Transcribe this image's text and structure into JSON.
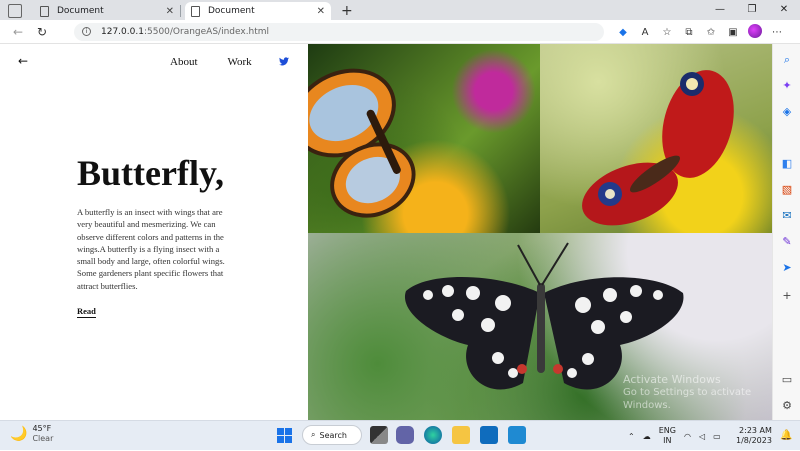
{
  "browser": {
    "tabs": [
      {
        "title": "Document",
        "active": false
      },
      {
        "title": "Document",
        "active": true
      }
    ],
    "new_tab": "+",
    "window_controls": {
      "minimize": "—",
      "maximize": "❐",
      "close": "✕"
    },
    "address": {
      "host": "127.0.0.1",
      "path": ":5500/OrangeAS/index.html"
    }
  },
  "page": {
    "back_icon": "←",
    "nav": {
      "about": "About",
      "work": "Work"
    },
    "social_icon": "twitter-icon",
    "title": "Butterfly,",
    "description": "A butterfly is an insect with wings that are very beautiful and mesmerizing. We can observe different colors and patterns in the wings.A butterfly is a flying insect with a small body and large, often colorful wings. Some gardeners plant specific flowers that attract butterflies.",
    "read_link": "Read",
    "watermark": {
      "line1": "Activate Windows",
      "line2": "Go to Settings to activate Windows."
    }
  },
  "taskbar": {
    "weather": {
      "temp": "45°F",
      "condition": "Clear"
    },
    "search_label": "Search",
    "lang": {
      "line1": "ENG",
      "line2": "IN"
    },
    "clock": {
      "time": "2:23 AM",
      "date": "1/8/2023"
    }
  },
  "colors": {
    "accent": "#1a73e8",
    "twitter": "#1d4ed8",
    "text": "#111111"
  }
}
